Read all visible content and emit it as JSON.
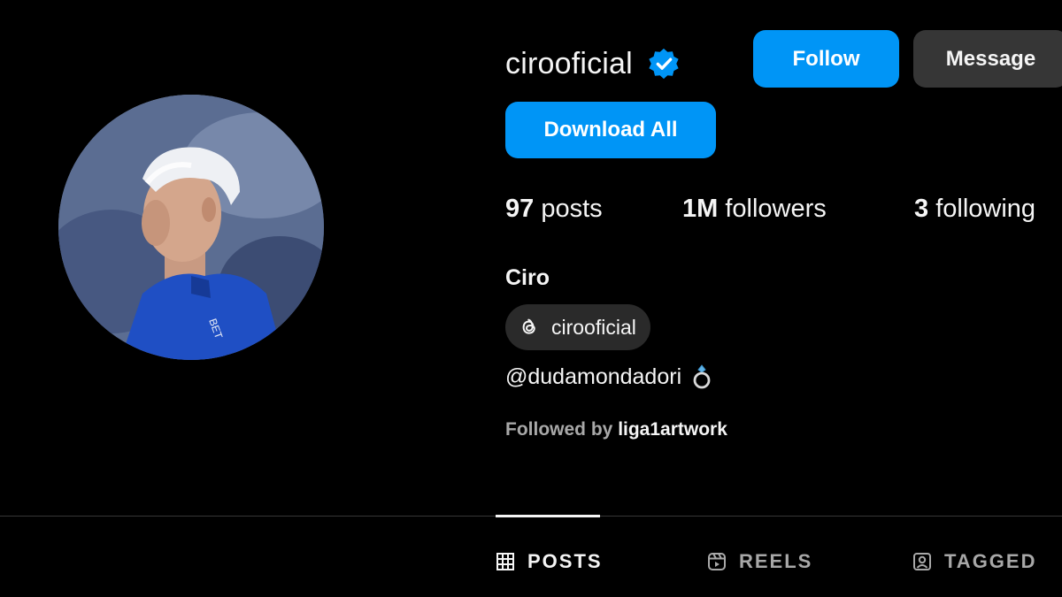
{
  "profile": {
    "username": "cirooficial",
    "full_name": "Ciro",
    "threads_handle": "cirooficial",
    "bio": "@dudamondadori",
    "followed_by_prefix": "Followed by",
    "followed_by_user": "liga1artwork"
  },
  "actions": {
    "follow_label": "Follow",
    "message_label": "Message",
    "download_label": "Download All"
  },
  "stats": {
    "posts_count": "97",
    "posts_label": "posts",
    "followers_count": "1M",
    "followers_label": "followers",
    "following_count": "3",
    "following_label": "following"
  },
  "tabs": [
    {
      "label": "POSTS",
      "icon": "grid-icon",
      "active": true
    },
    {
      "label": "REELS",
      "icon": "reels-icon",
      "active": false
    },
    {
      "label": "TAGGED",
      "icon": "tagged-icon",
      "active": false
    }
  ],
  "colors": {
    "background": "#000000",
    "primary_button": "#0095f6",
    "secondary_button": "#363636",
    "verified_badge": "#0095f6",
    "muted_text": "#a8a8a8"
  }
}
